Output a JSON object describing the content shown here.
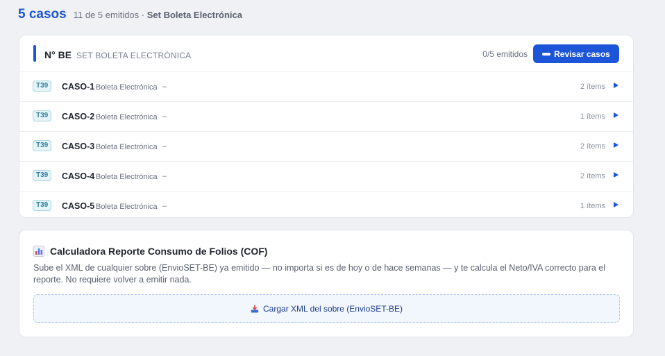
{
  "header": {
    "count": "5 casos",
    "subtitle_prefix": "11 de 5 emitidos ·",
    "subtitle_set": "Set Boleta Electrónica"
  },
  "set_card": {
    "title": "N° BE",
    "subtitle": "SET BOLETA ELECTRÓNICA",
    "emitted": "0/5 emitidos",
    "review_button": "Revisar casos",
    "rows": [
      {
        "tag": "T39",
        "name": "CASO-1",
        "type": "Boleta Electrónica",
        "dash": "–",
        "items": "2 ítems"
      },
      {
        "tag": "T39",
        "name": "CASO-2",
        "type": "Boleta Electrónica",
        "dash": "–",
        "items": "1 ítems"
      },
      {
        "tag": "T39",
        "name": "CASO-3",
        "type": "Boleta Electrónica",
        "dash": "–",
        "items": "2 ítems"
      },
      {
        "tag": "T39",
        "name": "CASO-4",
        "type": "Boleta Electrónica",
        "dash": "–",
        "items": "2 ítems"
      },
      {
        "tag": "T39",
        "name": "CASO-5",
        "type": "Boleta Electrónica",
        "dash": "–",
        "items": "1 ítems"
      }
    ]
  },
  "cof_card": {
    "icon": "bar-chart-icon",
    "title": "Calculadora Reporte Consumo de Folios (COF)",
    "description": "Sube el XML de cualquier sobre (EnvioSET-BE) ya emitido — no importa si es de hoy o de hace semanas — y te calcula el Neto/IVA correcto para el reporte. No requiere volver a emitir nada.",
    "upload_icon": "inbox-tray-icon",
    "upload_label": "Cargar XML del sobre (EnvioSET-BE)"
  },
  "colors": {
    "accent": "#1d55d8",
    "tag_bg": "#e6f4f8",
    "tag_text": "#2f7e9a",
    "page_bg": "#f0f1f5"
  }
}
